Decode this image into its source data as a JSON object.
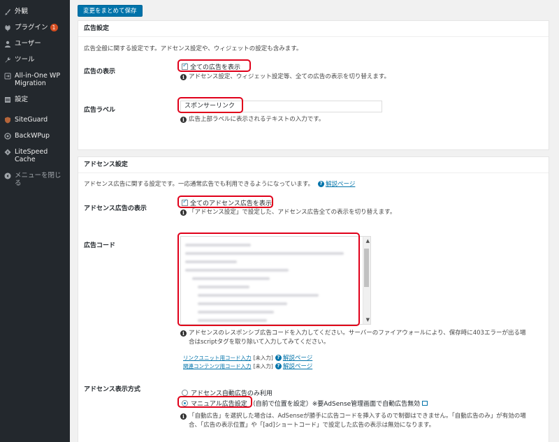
{
  "sidebar": {
    "items": [
      {
        "label": "外観",
        "icon": "paintbrush-icon"
      },
      {
        "label": "プラグイン",
        "icon": "plug-icon",
        "badge": "1"
      },
      {
        "label": "ユーザー",
        "icon": "user-icon"
      },
      {
        "label": "ツール",
        "icon": "wrench-icon"
      },
      {
        "label": "All-in-One WP Migration",
        "icon": "migration-icon"
      },
      {
        "label": "設定",
        "icon": "settings-icon"
      },
      {
        "label": "SiteGuard",
        "icon": "siteguard-icon"
      },
      {
        "label": "BackWPup",
        "icon": "backwpup-icon"
      },
      {
        "label": "LiteSpeed Cache",
        "icon": "litespeed-icon"
      },
      {
        "label": "メニューを閉じる",
        "icon": "collapse-icon"
      }
    ]
  },
  "toolbar": {
    "save_label": "変更をまとめて保存"
  },
  "ad_panel": {
    "title": "広告設定",
    "desc": "広告全般に関する設定です。アドセンス設定や、ウィジェットの設定も含みます。",
    "show_label": "広告の表示",
    "show_checkbox": "全ての広告を表示",
    "show_checked": true,
    "show_help": "アドセンス設定、ウィジェット設定等、全ての広告の表示を切り替えます。",
    "label_label": "広告ラベル",
    "label_value": "スポンサーリンク",
    "label_help": "広告上部ラベルに表示されるテキストの入力です。"
  },
  "adsense_panel": {
    "title": "アドセンス設定",
    "desc": "アドセンス広告に関する設定です。一応通常広告でも利用できるようになっています。",
    "desc_link": "解説ページ",
    "show_label": "アドセンス広告の表示",
    "show_checkbox": "全てのアドセンス広告を表示",
    "show_checked": true,
    "show_help": "「アドセンス設定」で設定した、アドセンス広告全ての表示を切り替えます。",
    "code_label": "広告コード",
    "code_help_1": "アドセンスのレスポンシブ広告コードを入力してください。サーバーのファイアウォールにより、保存時に403エラーが出る場",
    "code_help_2": "合はscriptタグを取り除いて入力してみてください。",
    "link1": "リンクユニット用コード入力",
    "link1_note": "[未入力]",
    "link1_help": "解説ページ",
    "link2": "関連コンテンツ用コード入力",
    "link2_note": "[未入力]",
    "link2_help": "解説ページ",
    "mode_label": "アドセンス表示方式",
    "mode_option1": "アドセンス自動広告のみ利用",
    "mode_option2": "マニュアル広告設定",
    "mode_option2_note": "（自前で位置を設定）※要AdSense管理画面で自動広告無効",
    "mode_selected": 2,
    "mode_help_1": "「自動広告」を選択した場合は、AdSenseが勝手に広告コードを挿入するので制御はできません。「自動広告のみ」が有効の場",
    "mode_help_2": "合、「広告の表示位置」や「[ad]ショートコード」で設定した広告の表示は無効になります。"
  }
}
